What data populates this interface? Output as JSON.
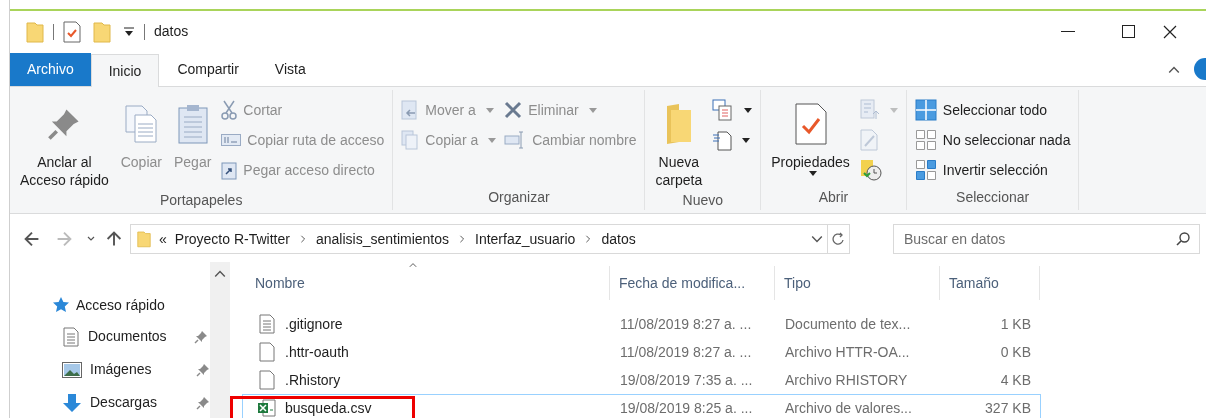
{
  "window": {
    "title": "datos"
  },
  "tabs": [
    {
      "label": "Archivo",
      "kind": "file",
      "selected": false
    },
    {
      "label": "Inicio",
      "kind": "normal",
      "selected": true
    },
    {
      "label": "Compartir",
      "kind": "normal",
      "selected": false
    },
    {
      "label": "Vista",
      "kind": "normal",
      "selected": false
    }
  ],
  "ribbon": [
    {
      "label": "Portapapeles",
      "items": [
        {
          "kind": "large",
          "label": "Anclar al\nAcceso rápido",
          "disabled": false
        },
        {
          "kind": "large",
          "label": "Copiar",
          "disabled": true
        },
        {
          "kind": "large",
          "label": "Pegar",
          "disabled": true
        },
        {
          "kind": "stack",
          "items": [
            {
              "label": "Cortar",
              "disabled": true,
              "dropdown": false
            },
            {
              "label": "Copiar ruta de acceso",
              "disabled": true,
              "dropdown": false
            },
            {
              "label": "Pegar acceso directo",
              "disabled": true,
              "dropdown": false
            }
          ]
        }
      ]
    },
    {
      "label": "Organizar",
      "items": [
        {
          "kind": "stack",
          "items": [
            {
              "label": "Mover a",
              "disabled": true,
              "dropdown": true
            },
            {
              "label": "Copiar a",
              "disabled": true,
              "dropdown": true
            }
          ]
        },
        {
          "kind": "stack",
          "items": [
            {
              "label": "Eliminar",
              "disabled": true,
              "dropdown": true
            },
            {
              "label": "Cambiar nombre",
              "disabled": true,
              "dropdown": false
            }
          ]
        }
      ]
    },
    {
      "label": "Nuevo",
      "items": [
        {
          "kind": "large",
          "label": "Nueva\ncarpeta",
          "disabled": false
        },
        {
          "kind": "stack",
          "items": [
            {
              "disabled": false,
              "dropdown": true
            },
            {
              "disabled": false,
              "dropdown": true
            }
          ]
        }
      ]
    },
    {
      "label": "Abrir",
      "items": [
        {
          "kind": "large",
          "label": "Propiedades",
          "disabled": false,
          "dropdown": true
        },
        {
          "kind": "stack",
          "items": [
            {
              "disabled": true,
              "dropdown": true
            },
            {
              "disabled": true,
              "dropdown": false
            },
            {
              "disabled": false,
              "dropdown": false
            }
          ]
        }
      ]
    },
    {
      "label": "Seleccionar",
      "items": [
        {
          "kind": "stack",
          "items": [
            {
              "label": "Seleccionar todo",
              "disabled": false,
              "dropdown": false
            },
            {
              "label": "No seleccionar nada",
              "disabled": false,
              "dropdown": false
            },
            {
              "label": "Invertir selección",
              "disabled": false,
              "dropdown": false
            }
          ]
        }
      ]
    }
  ],
  "address": {
    "overflow_mark": "«",
    "path": [
      "Proyecto R-Twitter",
      "analisis_sentimientos",
      "Interfaz_usuario",
      "datos"
    ]
  },
  "search": {
    "placeholder": "Buscar en datos"
  },
  "sidebar": {
    "items": [
      {
        "label": "Acceso rápido",
        "pinned": false,
        "children": [
          {
            "label": "Documentos",
            "pinned": true
          },
          {
            "label": "Imágenes",
            "pinned": true
          },
          {
            "label": "Descargas",
            "pinned": true
          }
        ]
      }
    ]
  },
  "table": {
    "columns": [
      "Nombre",
      "Fecha de modifica...",
      "Tipo",
      "Tamaño"
    ],
    "rows": [
      {
        "kind": "text",
        "name": ".gitignore",
        "date": "11/08/2019 8:27 a. ...",
        "type": "Documento de tex...",
        "size": "1 KB",
        "focused": false,
        "highlighted": false
      },
      {
        "kind": "blank",
        "name": ".httr-oauth",
        "date": "11/08/2019 8:27 a. ...",
        "type": "Archivo HTTR-OA...",
        "size": "0 KB",
        "focused": false,
        "highlighted": false
      },
      {
        "kind": "blank",
        "name": ".Rhistory",
        "date": "19/08/2019 7:35 a. ...",
        "type": "Archivo RHISTORY",
        "size": "4 KB",
        "focused": false,
        "highlighted": false
      },
      {
        "kind": "spreadsheet",
        "name": "busqueda.csv",
        "date": "19/08/2019 8:25 a. ...",
        "type": "Archivo de valores...",
        "size": "327 KB",
        "focused": true,
        "highlighted": true
      }
    ]
  }
}
